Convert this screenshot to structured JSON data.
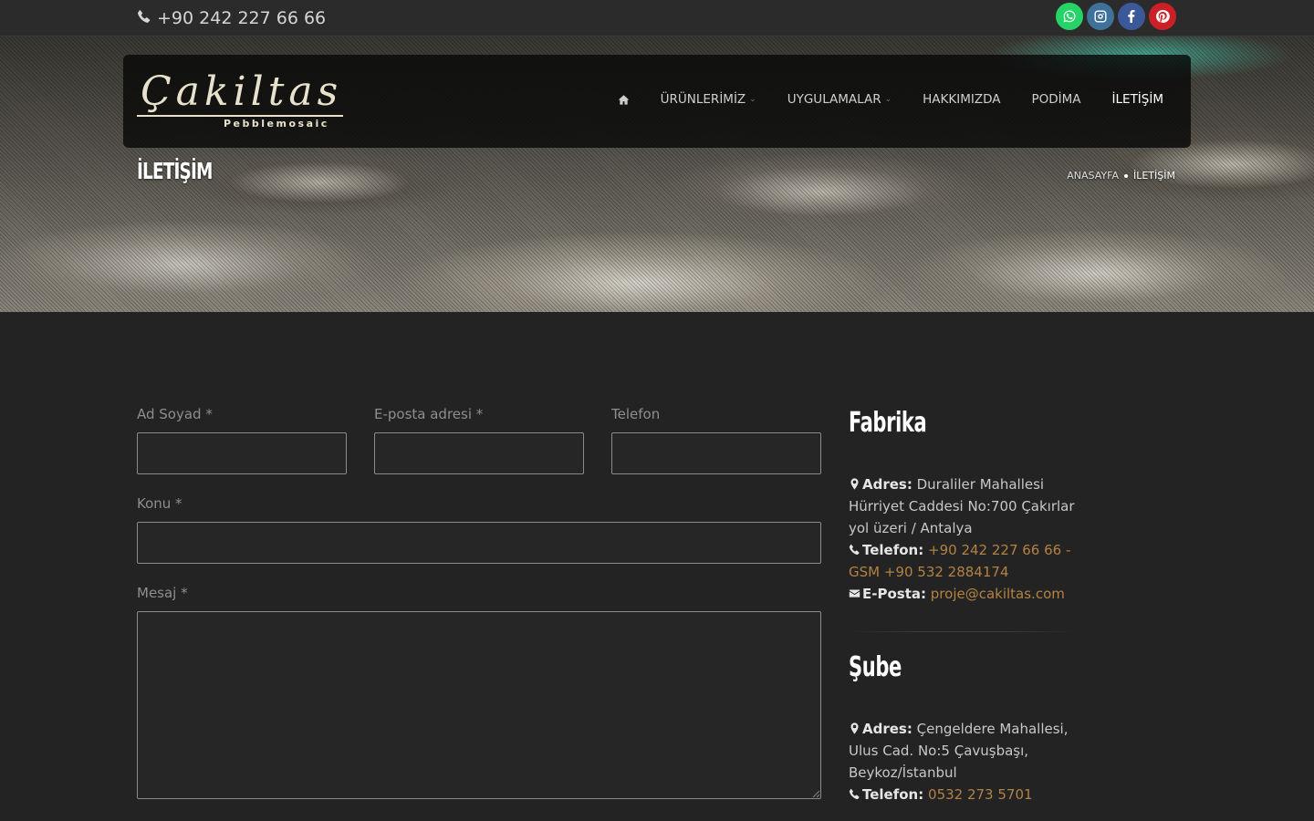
{
  "topbar": {
    "phone": "+90 242 227 66 66",
    "socials": [
      {
        "name": "whatsapp",
        "icon": "whatsapp-icon",
        "color": "#25d366"
      },
      {
        "name": "instagram",
        "icon": "instagram-icon",
        "color": "#3f729b"
      },
      {
        "name": "facebook",
        "icon": "facebook-icon",
        "color": "#3b5998"
      },
      {
        "name": "pinterest",
        "icon": "pinterest-icon",
        "color": "#cb2027"
      }
    ]
  },
  "logo": {
    "name": "Çakiltas",
    "tagline": "Pebblemosaic"
  },
  "nav": {
    "home_icon": "home-icon",
    "items": [
      {
        "label": "ÜRÜNLERİMİZ",
        "has_dropdown": true
      },
      {
        "label": "UYGULAMALAR",
        "has_dropdown": true
      },
      {
        "label": "HAKKIMIZDA",
        "has_dropdown": false
      },
      {
        "label": "PODİMA",
        "has_dropdown": false
      },
      {
        "label": "İLETİŞİM",
        "has_dropdown": false,
        "active": true
      }
    ]
  },
  "page": {
    "title": "İLETİŞİM",
    "breadcrumb": [
      "ANASAYFA",
      "İLETİŞİM"
    ]
  },
  "form": {
    "name_label": "Ad Soyad *",
    "email_label": "E-posta adresi *",
    "phone_label": "Telefon",
    "subject_label": "Konu *",
    "message_label": "Mesaj *",
    "name_value": "",
    "email_value": "",
    "phone_value": "",
    "subject_value": "",
    "message_value": ""
  },
  "contact": {
    "factory": {
      "title": "Fabrika",
      "address_label": "Adres:",
      "address": "Duraliler Mahallesi Hürriyet Caddesi No:700 Çakırlar yol üzeri / Antalya",
      "phone_label": "Telefon:",
      "phone": "+90 242 227 66 66 - GSM +90 532 2884174",
      "email_label": "E-Posta:",
      "email": "proje@cakiltas.com"
    },
    "branch": {
      "title": "Şube",
      "address_label": "Adres:",
      "address": "Çengeldere Mahallesi, Ulus Cad. No:5 Çavuşbaşı, Beykoz/İstanbul",
      "phone_label": "Telefon:",
      "phone": "0532 273 5701"
    }
  },
  "colors": {
    "background": "#232323",
    "link": "#b38243",
    "topbar": "#2b2b2b"
  }
}
